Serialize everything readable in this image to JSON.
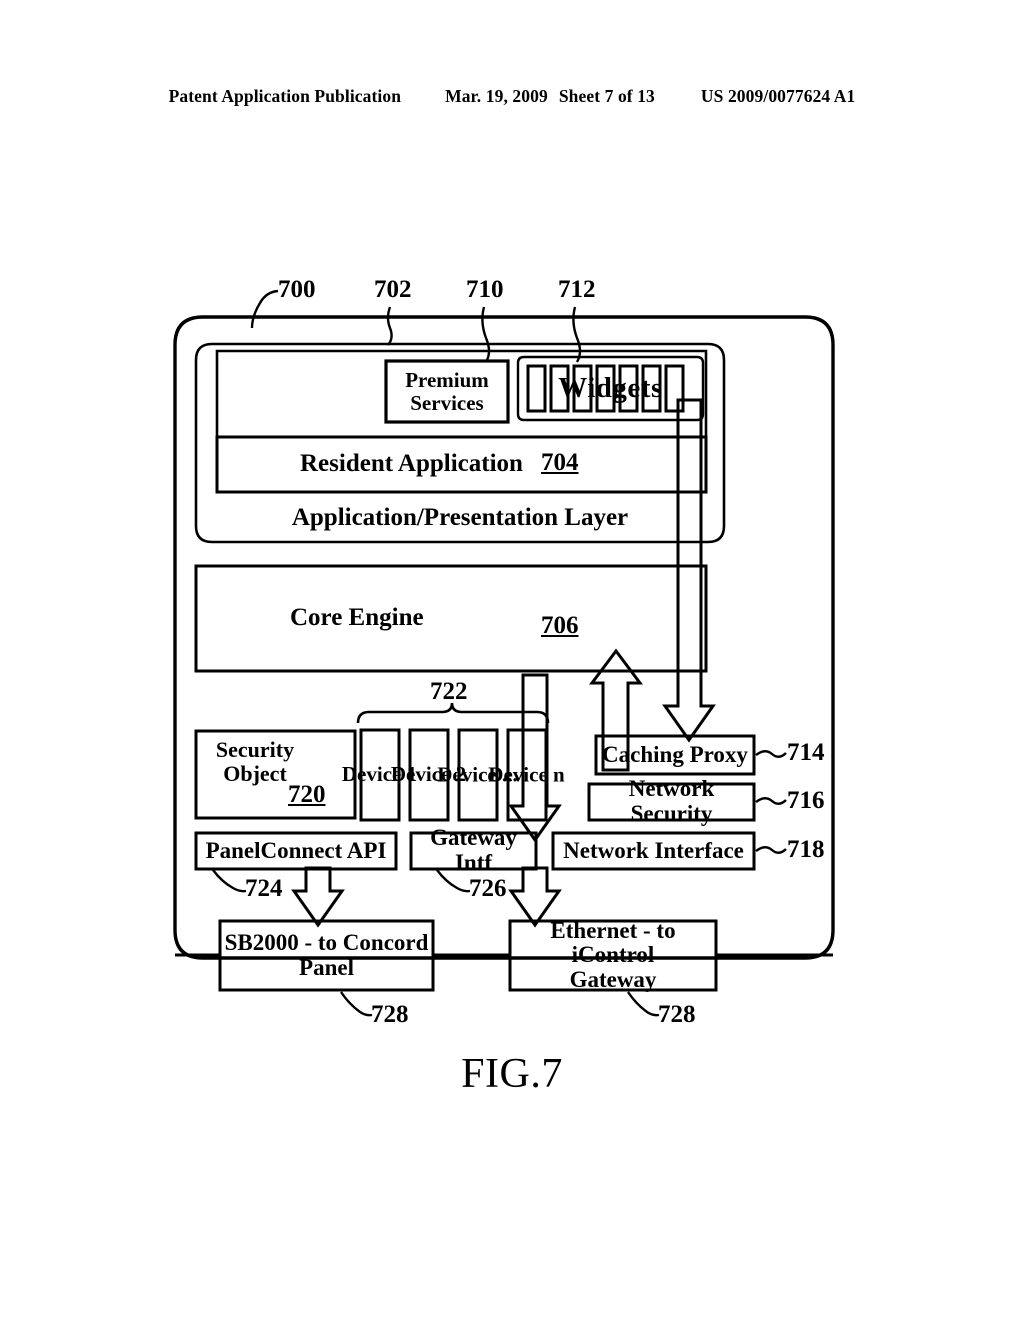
{
  "header": {
    "publication": "Patent Application Publication",
    "date": "Mar. 19, 2009",
    "sheet": "Sheet 7 of 13",
    "patent_number": "US 2009/0077624 A1"
  },
  "figure": {
    "caption": "FIG.7",
    "line_color": "#000000",
    "background": "#ffffff"
  },
  "blocks": {
    "premium_services": "Premium\nServices",
    "premium_services_line1": "Premium",
    "premium_services_line2": "Services",
    "widgets": "Widgets",
    "widget_slot_count": 7,
    "resident_application": "Resident Application",
    "application_presentation_layer": "Application/Presentation Layer",
    "core_engine": "Core Engine",
    "security_object_line1": "Security",
    "security_object_line2": "Object",
    "devices": [
      "Device 1",
      "Device 2",
      "Device ...",
      "Device n"
    ],
    "caching_proxy": "Caching Proxy",
    "network_security": "Network Security",
    "network_interface": "Network Interface",
    "panelconnect_api": "PanelConnect API",
    "gateway_intf": "Gateway Intf",
    "sb2000_line1": "SB2000 - to Concord",
    "sb2000_line2": "Panel",
    "ethernet_line1": "Ethernet - to iControl",
    "ethernet_line2": "Gateway"
  },
  "reference_numerals": {
    "outer_frame": "700",
    "inner_frame": "702",
    "premium_services": "710",
    "widgets": "712",
    "resident_application": "704",
    "core_engine": "706",
    "caching_proxy": "714",
    "network_security": "716",
    "network_interface": "718",
    "security_object": "720",
    "devices_bracket": "722",
    "panelconnect_api": "724",
    "gateway_intf": "726",
    "sb2000": "728",
    "ethernet": "728"
  }
}
